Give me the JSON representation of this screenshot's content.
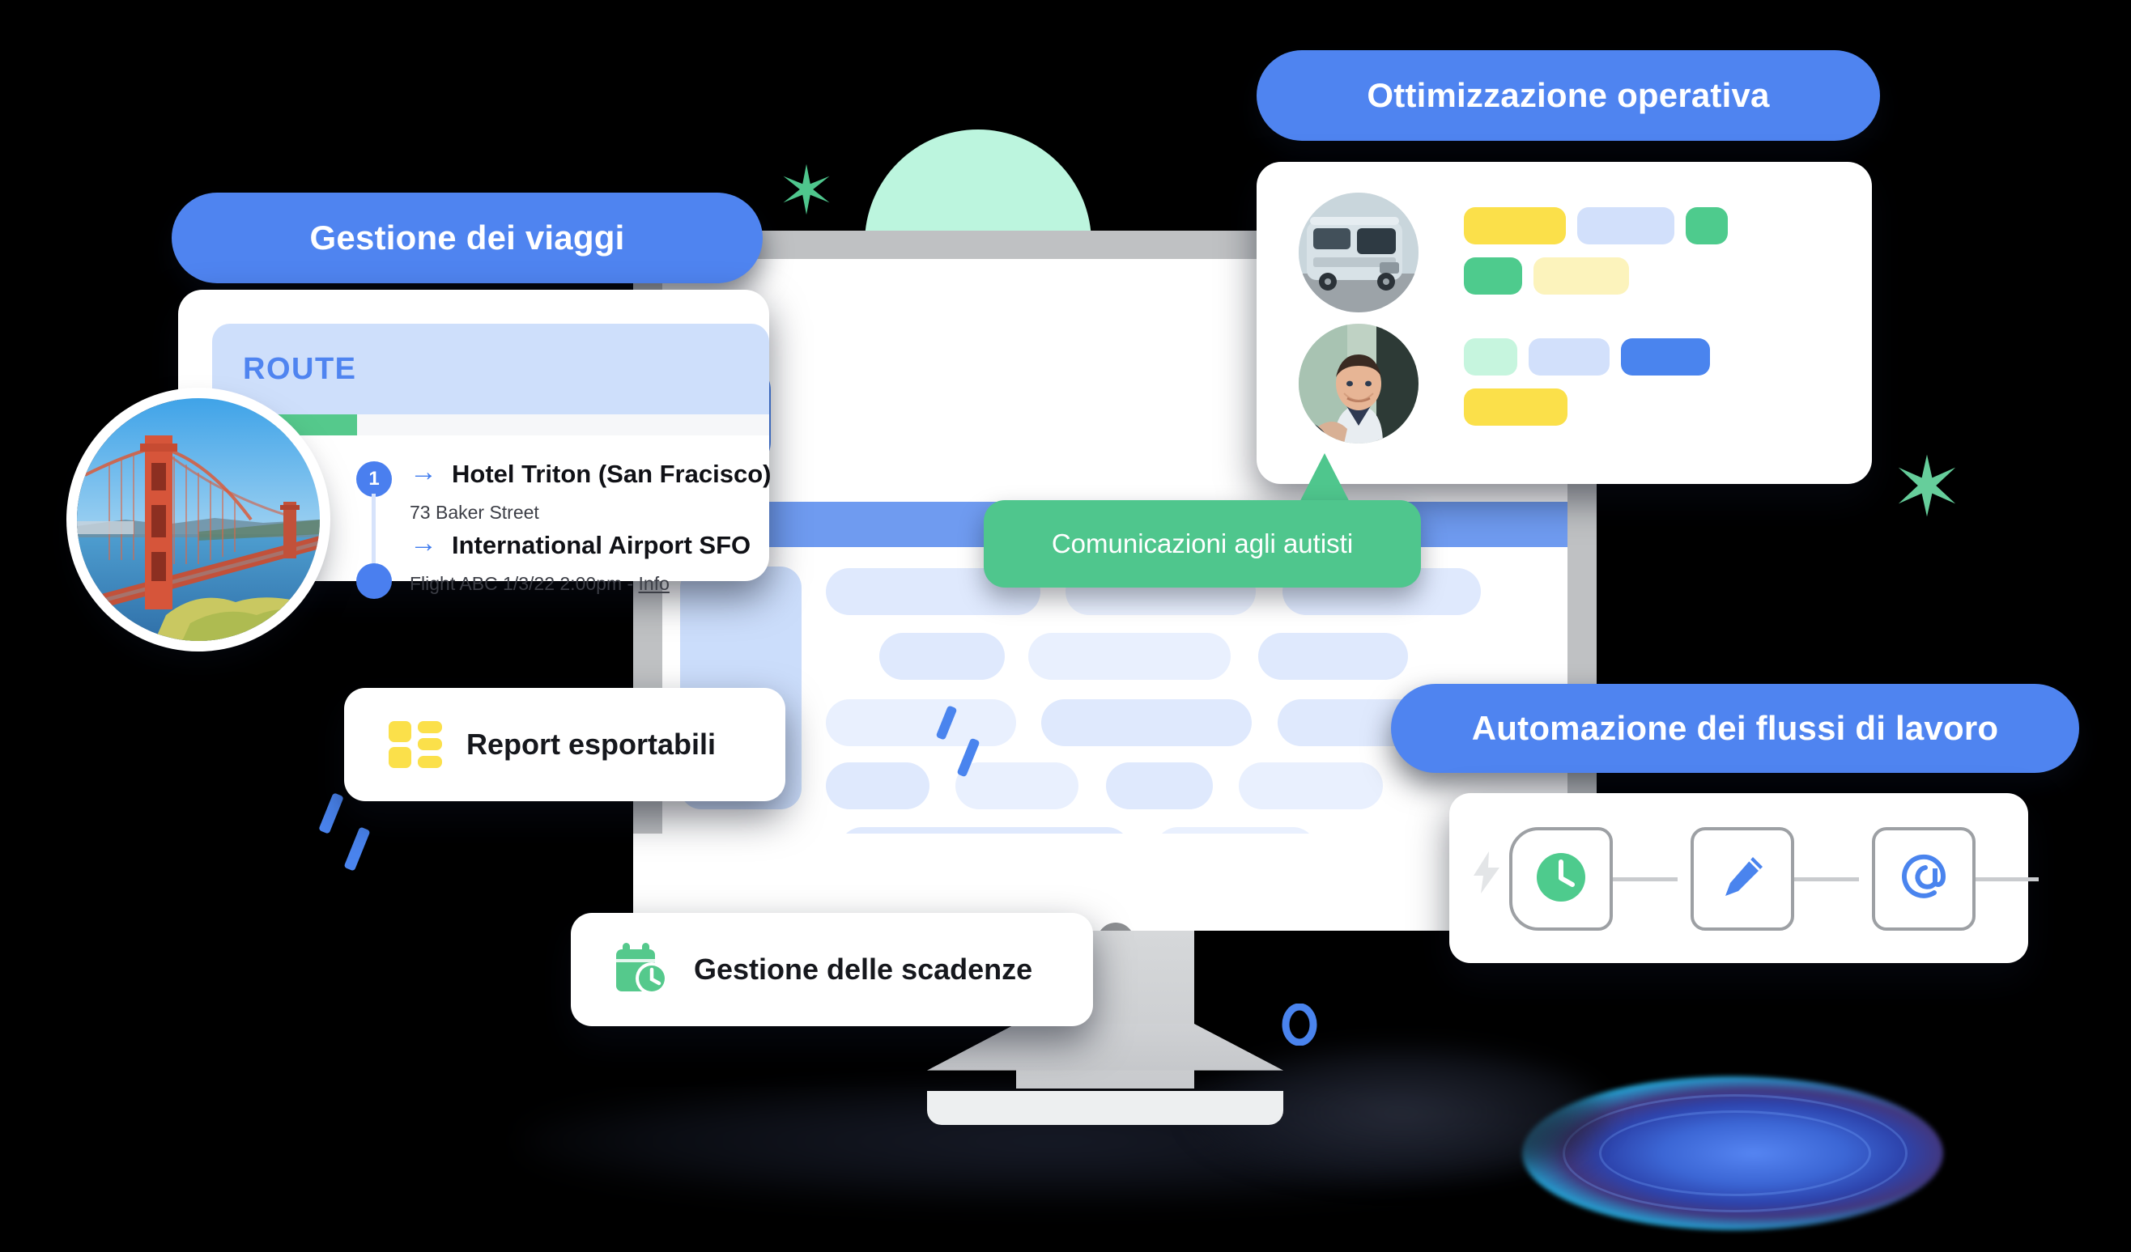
{
  "badges": {
    "travel_management": "Gestione dei viaggi",
    "operational_optimization": "Ottimizzazione operativa",
    "workflow_automation": "Automazione dei flussi di lavoro"
  },
  "tooltips": {
    "driver_communications": "Comunicazioni agli autisti"
  },
  "route_card": {
    "title": "ROUTE",
    "progress_percent": 26,
    "stops": [
      {
        "marker": "1",
        "arrow": "→",
        "name": "Hotel Triton (San Fracisco)",
        "detail": "73 Baker Street",
        "link": ""
      },
      {
        "marker": "",
        "arrow": "→",
        "name": "International Airport SFO",
        "detail": "Flight ABC 1/3/22 2:00pm - ",
        "link": "Info"
      }
    ]
  },
  "feature_cards": [
    {
      "label": "Report esportabili",
      "icon": "dashboard-grid-icon",
      "icon_color": "#FBE04A"
    },
    {
      "label": "Gestione delle scadenze",
      "icon": "calendar-clock-icon",
      "icon_color": "#55C98C"
    }
  ],
  "drivers_card": {
    "rows": [
      {
        "avatar": "bus-avatar",
        "bars": [
          {
            "color": "#FBE04A",
            "width": 126,
            "row": 0
          },
          {
            "color": "#D2E0FB",
            "width": 120,
            "row": 0
          },
          {
            "color": "#4ECB8D",
            "width": 52,
            "row": 0
          },
          {
            "color": "#4ECB8D",
            "width": 72,
            "row": 1
          },
          {
            "color": "#FCF3BC",
            "width": 118,
            "row": 1
          }
        ]
      },
      {
        "avatar": "driver-avatar",
        "bars": [
          {
            "color": "#C6F5DE",
            "width": 66,
            "row": 0
          },
          {
            "color": "#D2E0FB",
            "width": 100,
            "row": 0
          },
          {
            "color": "#4A84EE",
            "width": 110,
            "row": 0
          },
          {
            "color": "#FBE04A",
            "width": 128,
            "row": 1
          }
        ]
      }
    ]
  },
  "workflow_card": {
    "bolt_icon": "lightning-bolt-icon",
    "nodes": [
      {
        "icon": "clock-icon",
        "color": "#4ECB8D"
      },
      {
        "icon": "pencil-icon",
        "color": "#4A84EE"
      },
      {
        "icon": "at-sign-icon",
        "color": "#4A84EE"
      }
    ]
  },
  "decorations": {
    "sparkle_left": "sparkle-star-icon",
    "sparkle_right": "sparkle-star-icon",
    "mint_circle": "mint-circle-shape",
    "glow": "blue-glow-ellipse"
  },
  "colors": {
    "brand_blue": "#4F84F0",
    "accent_green": "#4FC68D",
    "accent_yellow": "#FBE04A",
    "pill_blue": "#DFE9FD",
    "monitor_gray": "#BFC1C3"
  }
}
